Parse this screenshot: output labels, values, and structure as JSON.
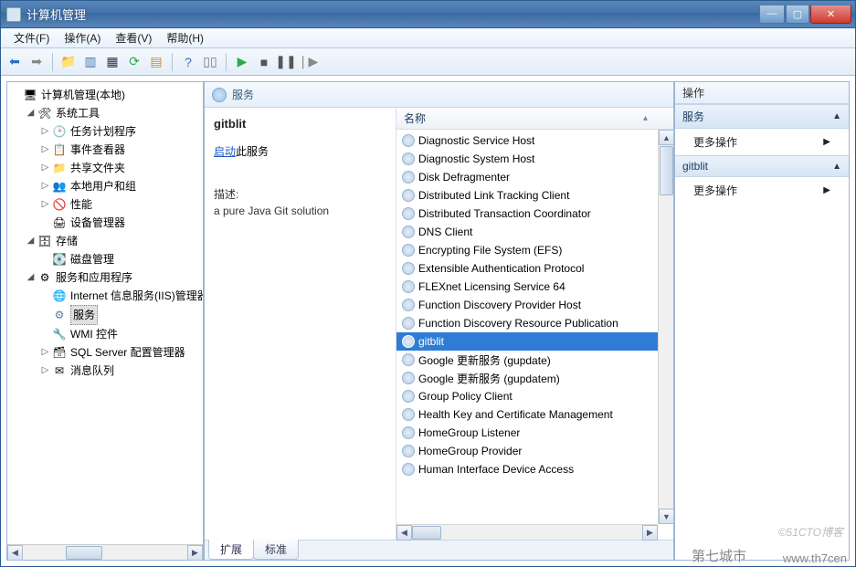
{
  "window": {
    "title": "计算机管理"
  },
  "menu": {
    "file": "文件(F)",
    "action": "操作(A)",
    "view": "查看(V)",
    "help": "帮助(H)"
  },
  "tree": {
    "root": "计算机管理(本地)",
    "sys_tools": "系统工具",
    "task_scheduler": "任务计划程序",
    "event_viewer": "事件查看器",
    "shared_folders": "共享文件夹",
    "local_users": "本地用户和组",
    "performance": "性能",
    "device_manager": "设备管理器",
    "storage": "存储",
    "disk_mgmt": "磁盘管理",
    "services_apps": "服务和应用程序",
    "iis": "Internet 信息服务(IIS)管理器",
    "services": "服务",
    "wmi": "WMI 控件",
    "sqlserver": "SQL Server 配置管理器",
    "msmq": "消息队列"
  },
  "center": {
    "header": "服务",
    "service_name": "gitblit",
    "start_link": "启动",
    "start_suffix": "此服务",
    "desc_label": "描述:",
    "desc_text": "a pure Java Git solution",
    "col_name": "名称",
    "tabs": {
      "extended": "扩展",
      "standard": "标准"
    }
  },
  "services": [
    "Diagnostic Service Host",
    "Diagnostic System Host",
    "Disk Defragmenter",
    "Distributed Link Tracking Client",
    "Distributed Transaction Coordinator",
    "DNS Client",
    "Encrypting File System (EFS)",
    "Extensible Authentication Protocol",
    "FLEXnet Licensing Service 64",
    "Function Discovery Provider Host",
    "Function Discovery Resource Publication",
    "gitblit",
    "Google 更新服务 (gupdate)",
    "Google 更新服务 (gupdatem)",
    "Group Policy Client",
    "Health Key and Certificate Management",
    "HomeGroup Listener",
    "HomeGroup Provider",
    "Human Interface Device Access"
  ],
  "selected_service_index": 11,
  "actions": {
    "title": "操作",
    "section1": "服务",
    "more": "更多操作",
    "section2": "gitblit"
  },
  "watermark": {
    "left": "第七城市",
    "right": "www.th7cen",
    "blog": "©51CTO博客"
  }
}
